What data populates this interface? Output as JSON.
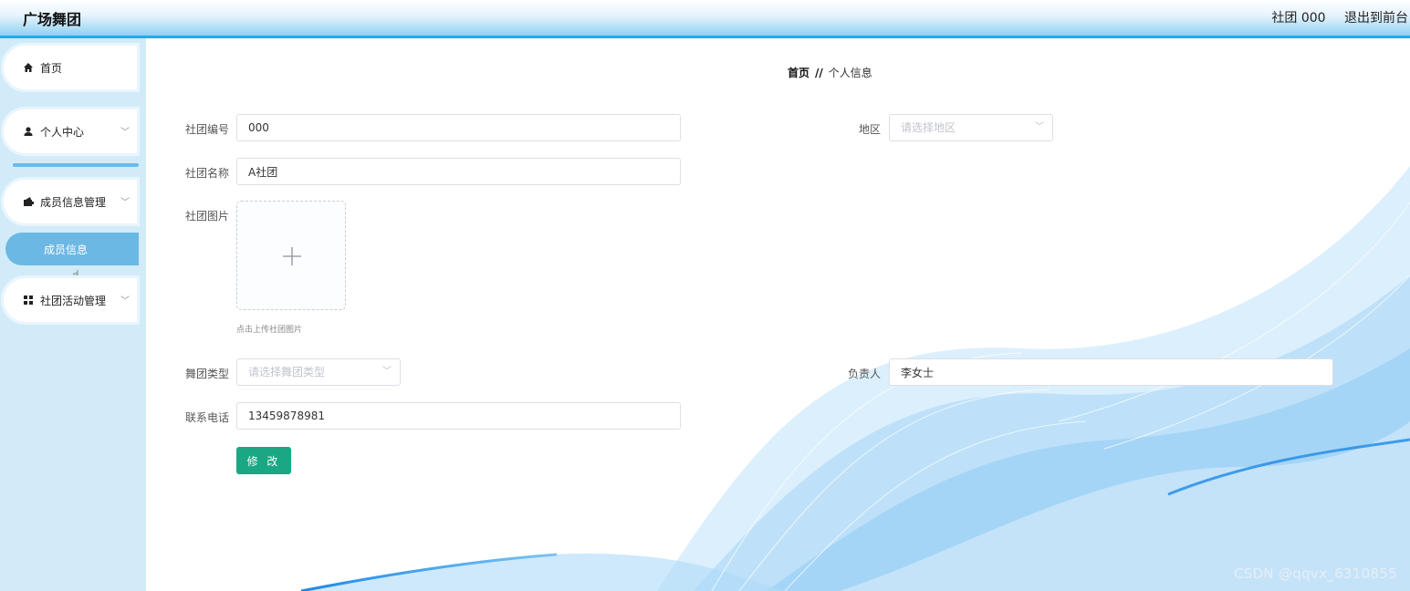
{
  "header": {
    "title": "广场舞团",
    "user_label": "社团 000",
    "logout_label": "退出到前台"
  },
  "sidebar": {
    "items": [
      {
        "label": "首页",
        "icon": "home-icon"
      },
      {
        "label": "个人中心",
        "icon": "user-icon"
      },
      {
        "label": "成员信息管理",
        "icon": "wallet-icon"
      },
      {
        "label": "社团活动管理",
        "icon": "grid-icon"
      }
    ],
    "active_sub_item": "成员信息"
  },
  "breadcrumb": {
    "home": "首页",
    "separator": "//",
    "current": "个人信息"
  },
  "form": {
    "club_no": {
      "label": "社团编号",
      "value": "000"
    },
    "region": {
      "label": "地区",
      "placeholder": "请选择地区"
    },
    "club_name": {
      "label": "社团名称",
      "value": "A社团"
    },
    "club_image": {
      "label": "社团图片",
      "tip": "点击上传社团图片"
    },
    "dance_type": {
      "label": "舞团类型",
      "placeholder": "请选择舞团类型"
    },
    "leader": {
      "label": "负责人",
      "value": "李女士"
    },
    "phone": {
      "label": "联系电话",
      "value": "13459878981"
    },
    "submit_label": "修 改"
  },
  "watermark": "CSDN @qqvx_6310855",
  "colors": {
    "accent": "#29a9ea",
    "sidebar_bg": "#d2ebf8",
    "active_sub_bg": "#6cb8e4",
    "button": "#1aa784"
  }
}
